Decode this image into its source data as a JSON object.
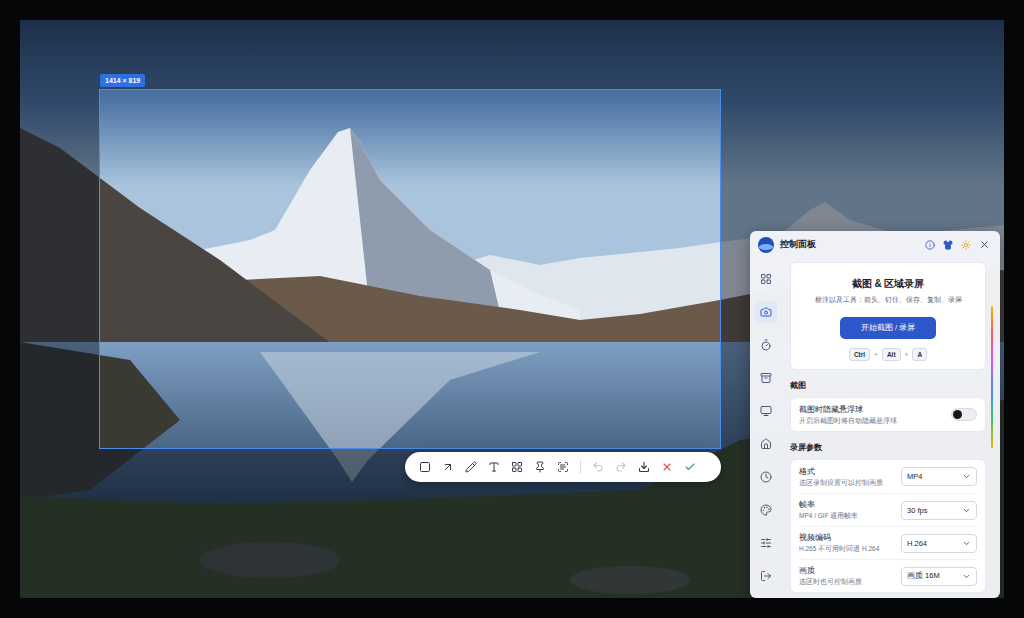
{
  "selection": {
    "size_badge": "1414 × 819"
  },
  "toolbar": {
    "tools": [
      {
        "selected": false
      },
      {
        "selected": false
      },
      {
        "selected": false
      },
      {
        "selected": false
      },
      {
        "selected": false
      },
      {
        "selected": false
      },
      {
        "selected": false
      }
    ],
    "actions": [
      {
        "disabled": true
      },
      {
        "disabled": true
      },
      {
        "disabled": false
      },
      {
        "disabled": false
      },
      {
        "disabled": false
      }
    ]
  },
  "panel": {
    "title": "控制面板",
    "sidebar": {
      "items": [
        {
          "selected": false
        },
        {
          "selected": true
        },
        {
          "selected": false
        },
        {
          "selected": false
        },
        {
          "selected": false
        },
        {
          "selected": false
        },
        {
          "selected": false
        },
        {
          "selected": false
        },
        {
          "selected": false
        },
        {
          "selected": false
        }
      ]
    },
    "hero": {
      "title": "截图 & 区域录屏",
      "subtitle": "标注以及工具：箭头、钉住、保存、复制、录屏",
      "button": "开始截图 / 录屏",
      "shortcut": {
        "keys": [
          "Ctrl",
          "Alt",
          "A"
        ],
        "separator": "+"
      }
    },
    "sections": [
      {
        "title": "截图",
        "rows": [
          {
            "kind": "toggle",
            "label": "截图时隐藏悬浮球",
            "hint": "开启后截图时将自动隐藏悬浮球",
            "on": false
          }
        ]
      },
      {
        "title": "录屏参数",
        "rows": [
          {
            "kind": "select",
            "label": "格式",
            "hint": "选区录制设置可以控制画质",
            "value": "MP4"
          },
          {
            "kind": "select",
            "label": "帧率",
            "hint": "MP4 / GIF 通用帧率",
            "value": "30 fps"
          },
          {
            "kind": "select",
            "label": "视频编码",
            "hint": "H.265 不可用时回退 H.264",
            "value": "H.264"
          },
          {
            "kind": "select",
            "label": "画质",
            "hint": "选区时也可控制画质",
            "value": "画质 16M"
          }
        ]
      }
    ]
  }
}
